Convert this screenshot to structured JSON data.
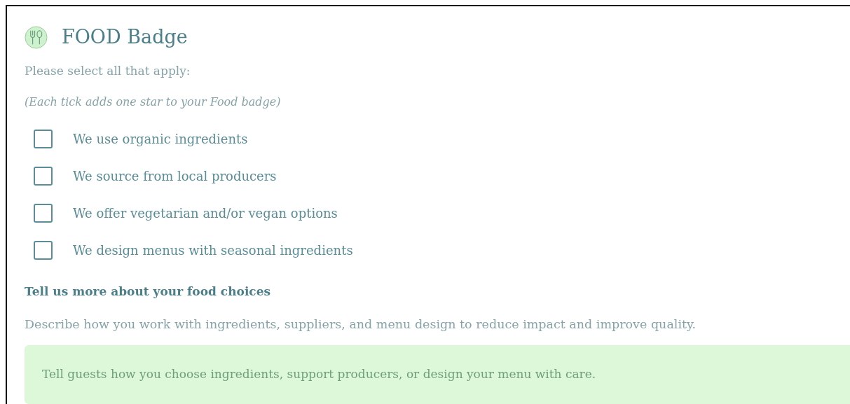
{
  "badge": {
    "title": "FOOD Badge"
  },
  "instruction": "Please select all that apply:",
  "note": "(Each tick adds one star to your Food badge)",
  "options": [
    {
      "label": "We use organic ingredients",
      "checked": false
    },
    {
      "label": "We source from local producers",
      "checked": false
    },
    {
      "label": "We offer vegetarian and/or vegan options",
      "checked": false
    },
    {
      "label": "We design menus with seasonal ingredients",
      "checked": false
    }
  ],
  "more": {
    "heading": "Tell us more about your food choices",
    "description": "Describe how you work with ingredients, suppliers, and menu design to reduce impact and improve quality.",
    "placeholder": "Tell guests how you choose ingredients, support producers, or design your menu with care."
  }
}
